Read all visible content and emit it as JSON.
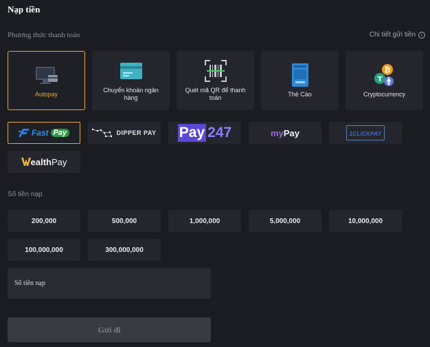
{
  "page": {
    "title": "Nạp tiền"
  },
  "payment_method": {
    "label": "Phương thức thanh toán",
    "detail_link": "Chi tiết gửi tiền",
    "methods": [
      {
        "label": "Autopay",
        "icon": "monitor-card-icon",
        "active": true
      },
      {
        "label": "Chuyển khoản ngân hàng",
        "icon": "bank-card-icon",
        "active": false
      },
      {
        "label": "Quét mã QR để thanh toán",
        "icon": "qr-scan-icon",
        "active": false
      },
      {
        "label": "Thẻ Cào",
        "icon": "scratch-card-icon",
        "active": false
      },
      {
        "label": "Cryptocurrency",
        "icon": "crypto-coins-icon",
        "active": false
      }
    ]
  },
  "providers": [
    {
      "name": "FastPay",
      "logo_text_1": "Fast",
      "logo_text_2": "Pay",
      "active": true
    },
    {
      "name": "DIPPER PAY",
      "logo_text": "DIPPER PAY",
      "active": false
    },
    {
      "name": "Pay247",
      "logo_text_1": "Pay",
      "logo_text_2": "247",
      "active": false
    },
    {
      "name": "myPay",
      "logo_text_1": "my",
      "logo_text_2": "Pay",
      "active": false
    },
    {
      "name": "1CLICKPAY",
      "logo_text": "1CLICKPAY",
      "active": false
    },
    {
      "name": "WealthPay",
      "logo_text_1": "ealth",
      "logo_text_2": "Pay",
      "active": false
    }
  ],
  "amount": {
    "label": "Số tiền nạp",
    "options": [
      "200,000",
      "500,000",
      "1,000,000",
      "5,000,000",
      "10,000,000",
      "100,000,000",
      "300,000,000"
    ],
    "input_placeholder": "Số tiền nạp",
    "input_value": ""
  },
  "submit_label": "Gửi đi",
  "colors": {
    "accent": "#f0a434",
    "background": "#1b1c21",
    "card": "#25262d"
  }
}
